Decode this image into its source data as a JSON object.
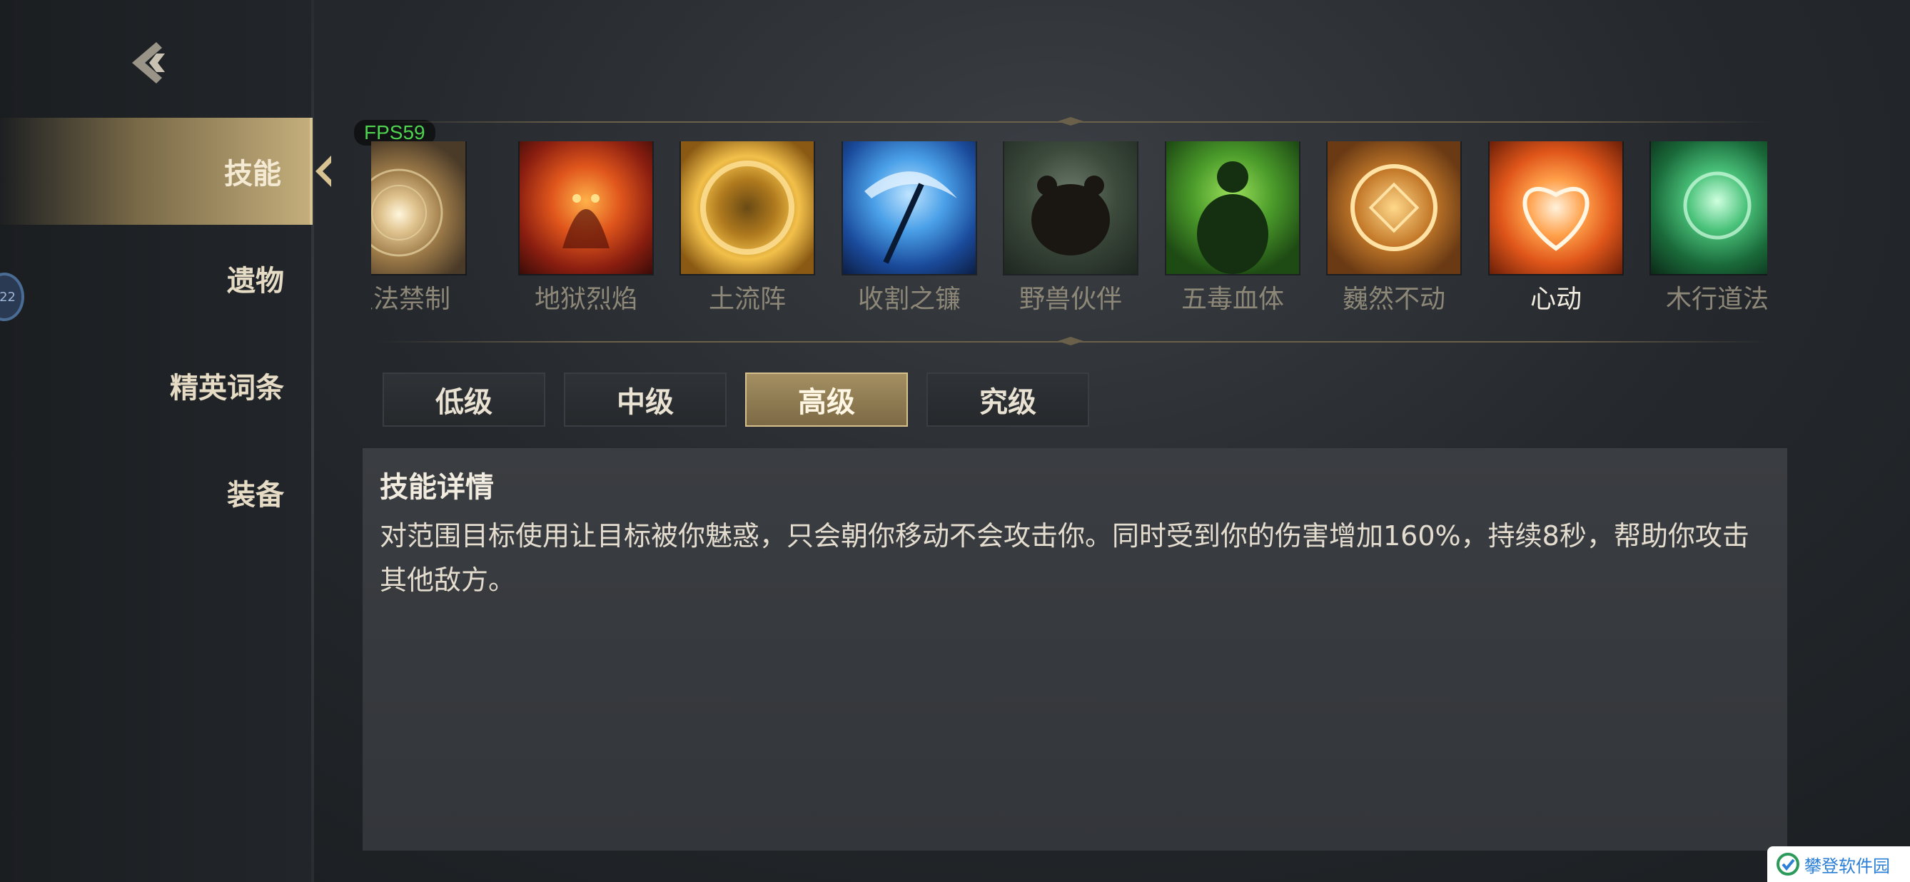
{
  "fps": "FPS59",
  "sidebar": {
    "items": [
      {
        "label": "技能",
        "active": true
      },
      {
        "label": "遗物",
        "active": false
      },
      {
        "label": "精英词条",
        "active": false
      },
      {
        "label": "装备",
        "active": false
      }
    ],
    "badge": "22"
  },
  "skills": [
    {
      "name": "灭法禁制",
      "icon": "light-burst-icon",
      "color": "#c9a56a"
    },
    {
      "name": "地狱烈焰",
      "icon": "fire-demon-icon",
      "color": "#c2421a"
    },
    {
      "name": "土流阵",
      "icon": "golden-ring-icon",
      "color": "#d89a2a"
    },
    {
      "name": "收割之镰",
      "icon": "ice-scythe-icon",
      "color": "#2a7fd0"
    },
    {
      "name": "野兽伙伴",
      "icon": "bear-icon",
      "color": "#3c4a3a"
    },
    {
      "name": "五毒血体",
      "icon": "poison-warrior-icon",
      "color": "#3f8a2a"
    },
    {
      "name": "巍然不动",
      "icon": "golden-shield-icon",
      "color": "#c47a2a"
    },
    {
      "name": "心动",
      "icon": "heart-swirl-icon",
      "color": "#f07a22",
      "selected": true
    },
    {
      "name": "木行道法",
      "icon": "green-vortex-icon",
      "color": "#3a9a5a"
    }
  ],
  "tiers": [
    {
      "label": "低级",
      "active": false
    },
    {
      "label": "中级",
      "active": false
    },
    {
      "label": "高级",
      "active": true
    },
    {
      "label": "究级",
      "active": false
    }
  ],
  "detail": {
    "title": "技能详情",
    "description": "对范围目标使用让目标被你魅惑，只会朝你移动不会攻击你。同时受到你的伤害增加160%，持续8秒，帮助你攻击其他敌方。"
  },
  "watermark": "攀登软件园",
  "colors": {
    "accent_gold": "#c4ae7c",
    "fps_green": "#4fd24f"
  }
}
